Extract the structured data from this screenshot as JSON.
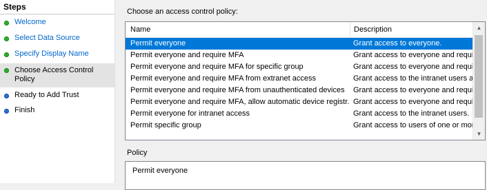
{
  "steps": {
    "title": "Steps",
    "items": [
      {
        "label": "Welcome",
        "status": "done"
      },
      {
        "label": "Select Data Source",
        "status": "done"
      },
      {
        "label": "Specify Display Name",
        "status": "done"
      },
      {
        "label": "Choose Access Control Policy",
        "status": "current"
      },
      {
        "label": "Ready to Add Trust",
        "status": "todo"
      },
      {
        "label": "Finish",
        "status": "todo"
      }
    ]
  },
  "policy_list": {
    "label": "Choose an access control policy:",
    "columns": [
      "Name",
      "Description"
    ],
    "rows": [
      {
        "name": "Permit everyone",
        "description": "Grant access to everyone.",
        "selected": true
      },
      {
        "name": "Permit everyone and require MFA",
        "description": "Grant access to everyone and requir"
      },
      {
        "name": "Permit everyone and require MFA for specific group",
        "description": "Grant access to everyone and requir"
      },
      {
        "name": "Permit everyone and require MFA from extranet access",
        "description": "Grant access to the intranet users an"
      },
      {
        "name": "Permit everyone and require MFA from unauthenticated devices",
        "description": "Grant access to everyone and requir"
      },
      {
        "name": "Permit everyone and require MFA, allow automatic device registr...",
        "description": "Grant access to everyone and requir"
      },
      {
        "name": "Permit everyone for intranet access",
        "description": "Grant access to the intranet users."
      },
      {
        "name": "Permit specific group",
        "description": "Grant access to users of one or more"
      }
    ]
  },
  "policy": {
    "label": "Policy",
    "value": "Permit everyone"
  },
  "colors": {
    "selection": "#0078d7",
    "done_dot": "#2bb02b",
    "todo_dot": "#2f6fd6",
    "link": "#0066cc"
  }
}
